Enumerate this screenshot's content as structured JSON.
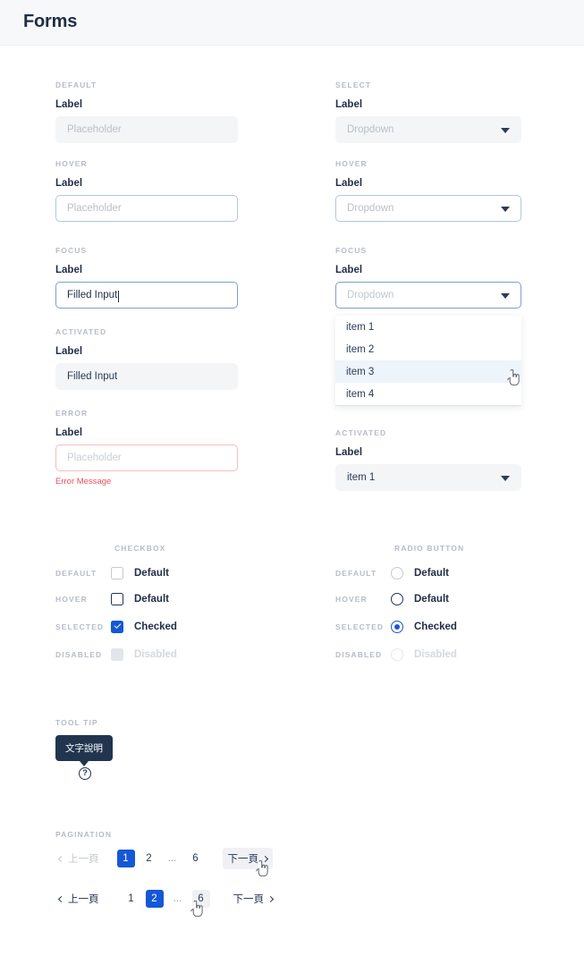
{
  "header": {
    "title": "Forms"
  },
  "states": {
    "default": "DEFAULT",
    "hover": "HOVER",
    "focus": "FOCUS",
    "activated": "ACTIVATED",
    "error": "ERROR",
    "selected": "SELECTED",
    "disabled": "DISABLED"
  },
  "sections": {
    "select_caption": "SELECT",
    "checkbox_caption": "CHECKBOX",
    "radio_caption": "RADIO BUTTON",
    "tooltip_caption": "TOOL TIP",
    "pagination_caption": "PAGINATION"
  },
  "text_inputs": {
    "label": "Label",
    "placeholder": "Placeholder",
    "filled_value": "Filled Input",
    "error_message": "Error Message"
  },
  "selects": {
    "label": "Label",
    "placeholder": "Dropdown",
    "selected_value": "item 1",
    "options": [
      "item 1",
      "item 2",
      "item 3",
      "item 4"
    ],
    "highlighted_option": "item 3"
  },
  "checkbox": {
    "default_label": "Default",
    "hover_label": "Default",
    "selected_label": "Checked",
    "disabled_label": "Disabled"
  },
  "radio": {
    "default_label": "Default",
    "hover_label": "Default",
    "selected_label": "Checked",
    "disabled_label": "Disabled"
  },
  "tooltip": {
    "bubble_text": "文字說明",
    "help_icon_glyph": "?"
  },
  "pagination": {
    "prev_label": "上一頁",
    "next_label": "下一頁",
    "ellipsis": "...",
    "row1": {
      "pages": [
        "1",
        "2",
        "...",
        "6"
      ],
      "active": "1",
      "prev_enabled": false,
      "next_hovered": true
    },
    "row2": {
      "pages": [
        "1",
        "2",
        "...",
        "6"
      ],
      "active": "2",
      "hovered_page": "6",
      "prev_enabled": true,
      "next_hovered": false
    }
  },
  "colors": {
    "brand_blue": "#1557d6",
    "navy": "#22354f",
    "error_red": "#e8515d",
    "error_border": "#f6bcc1",
    "fill_gray": "#f4f5f7",
    "hover_border": "#aec6e8",
    "focus_border": "#7e9fd0",
    "highlight_blue": "#eef4fc",
    "caption_gray": "#b6bcc6"
  }
}
